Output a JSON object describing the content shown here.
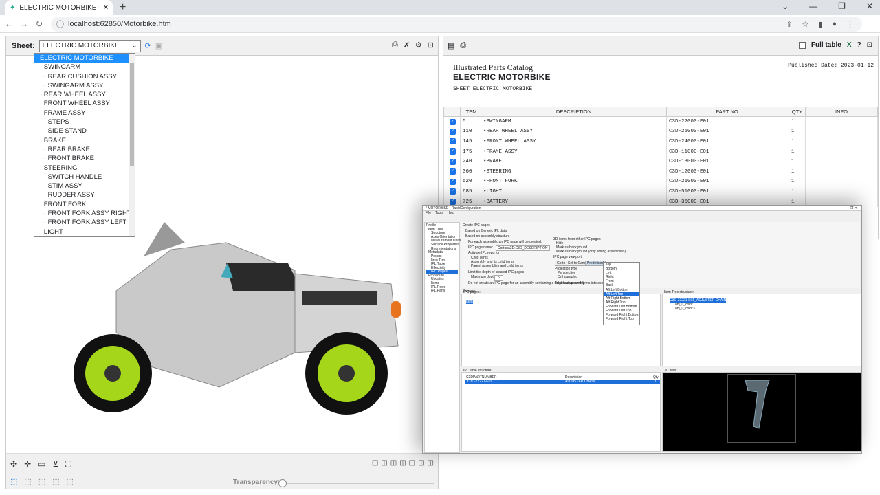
{
  "browser": {
    "tab_title": "ELECTRIC MOTORBIKE - Cortona",
    "new_tab": "+",
    "url": "localhost:62850/Motorbike.htm"
  },
  "viewer": {
    "sheet_label": "Sheet:",
    "sheet_value": "ELECTRIC MOTORBIKE",
    "dropdown_items": [
      "ELECTRIC MOTORBIKE",
      "· SWINGARM",
      "· · REAR CUSHION ASSY",
      "· · SWINGARM ASSY",
      "· REAR WHEEL ASSY",
      "· FRONT WHEEL ASSY",
      "· FRAME ASSY",
      "· · STEPS",
      "· · SIDE STAND",
      "· BRAKE",
      "· · REAR BRAKE",
      "· · FRONT BRAKE",
      "· STEERING",
      "· · SWITCH HANDLE",
      "· · STIM ASSY",
      "· · RUDDER ASSY",
      "· FRONT FORK",
      "· · FRONT FORK ASSY RIGHT",
      "· · FRONT FORK ASSY LEFT",
      "· LIGHT"
    ],
    "transparency_label": "Transparency:",
    "transparency_value": 0
  },
  "catalog": {
    "full_table_label": "Full table",
    "help": "?",
    "title": "Illustrated Parts Catalog",
    "subtitle": "ELECTRIC MOTORBIKE",
    "sheet": "SHEET ELECTRIC MOTORBIKE",
    "published": "Published Date: 2023-01-12",
    "columns": [
      "",
      "ITEM",
      "DESCRIPTION",
      "PART NO.",
      "QTY",
      "INFO"
    ],
    "rows": [
      {
        "item": "5",
        "desc": "•SWINGARM",
        "part": "C3D-22000-E01",
        "qty": "1"
      },
      {
        "item": "110",
        "desc": "•REAR WHEEL ASSY",
        "part": "C3D-25000-E01",
        "qty": "1"
      },
      {
        "item": "145",
        "desc": "•FRONT WHEEL ASSY",
        "part": "C3D-24000-E01",
        "qty": "1"
      },
      {
        "item": "175",
        "desc": "•FRAME ASSY",
        "part": "C3D-11000-E01",
        "qty": "1"
      },
      {
        "item": "240",
        "desc": "•BRAKE",
        "part": "C3D-13000-E01",
        "qty": "1"
      },
      {
        "item": "360",
        "desc": "•STEERING",
        "part": "C3D-12000-E01",
        "qty": "1"
      },
      {
        "item": "520",
        "desc": "•FRONT FORK",
        "part": "C3D-21000-E01",
        "qty": "1"
      },
      {
        "item": "685",
        "desc": "•LIGHT",
        "part": "C3D-51000-E01",
        "qty": "1"
      },
      {
        "item": "725",
        "desc": "•BATTERY",
        "part": "C3D-35000-E01",
        "qty": "1"
      }
    ]
  },
  "rapidconfig": {
    "title": "* MOTORBIKE - RapidConfiguration",
    "menu": [
      "File",
      "Tools",
      "Help"
    ],
    "tree": [
      "Profile",
      "Item Tree",
      "Structure",
      "Axes Orientation",
      "Measurement Units",
      "Surface Properties",
      "Representations",
      "Metadata",
      "Project",
      "Item Tree",
      "IPL Table",
      "Effectivity",
      "IPC Pages",
      "Procedure",
      "Updates",
      "Items",
      "IPL Rows",
      "IPL Parts"
    ],
    "opt_create": "Create IPC pages",
    "opt_generic": "Based on Generic IPL data",
    "opt_assembly": "Based on assembly structure",
    "opt_each": "For each assembly, an IPC page will be created.",
    "page_name_label": "IPC page name:",
    "page_name_value": "Cortona3D:C3D_DESCRIPTION",
    "activate_label": "Activate IPL rows for",
    "act_child": "Child items",
    "act_assembly": "Assembly and its child items",
    "act_parent": "Parent assemblies and child items",
    "limit_depth": "Limit the depth of created IPC pages",
    "max_depth_label": "Maximum depth:",
    "max_depth": "5",
    "no_create": "Do not create an IPC page for an assembly containing a single subassembly",
    "other3d_label": "3D items from other IPC pages",
    "o_hide": "Hide",
    "o_bg": "Mark as background",
    "o_bg2": "Mark as background (only sibling assemblies)",
    "viewport_label": "IPC page viewport",
    "goto": "Go to",
    "settocam": "Set to Camera",
    "predefined": "Predefined",
    "projection_label": "Projection type",
    "p_persp": "Perspective",
    "p_ortho": "Orthographic",
    "take_bg": "Take background items into account",
    "dd_items": [
      "Top",
      "Bottom",
      "Left",
      "Right",
      "Front",
      "Back",
      "Aft Left Bottom",
      "Aft Left Top",
      "Aft Right Bottom",
      "Aft Right Top",
      "Forward Left Bottom",
      "Forward Left Top",
      "Forward Right Bottom",
      "Forward Right Top"
    ],
    "dd_selected": "Aft Left Top",
    "preview_label": "Preview",
    "ipc_pages_label": "IPC pages:",
    "ipc_page_item": "Item",
    "item_tree_label": "Item Tree structure:",
    "item_tree_items": [
      "C3D-22221-E01_ADJUSTER CHAIN",
      "obj_0_color1",
      "obj_0_color3"
    ],
    "ipl_label": "IPL table structure:",
    "ipl_cols": [
      "C3DPARTNUMBER",
      "Description",
      "Qty"
    ],
    "ipl_row": [
      "C3D-22221-E01",
      "ADJUSTER CHAIN",
      "1"
    ],
    "item3d_label": "3D item:"
  }
}
